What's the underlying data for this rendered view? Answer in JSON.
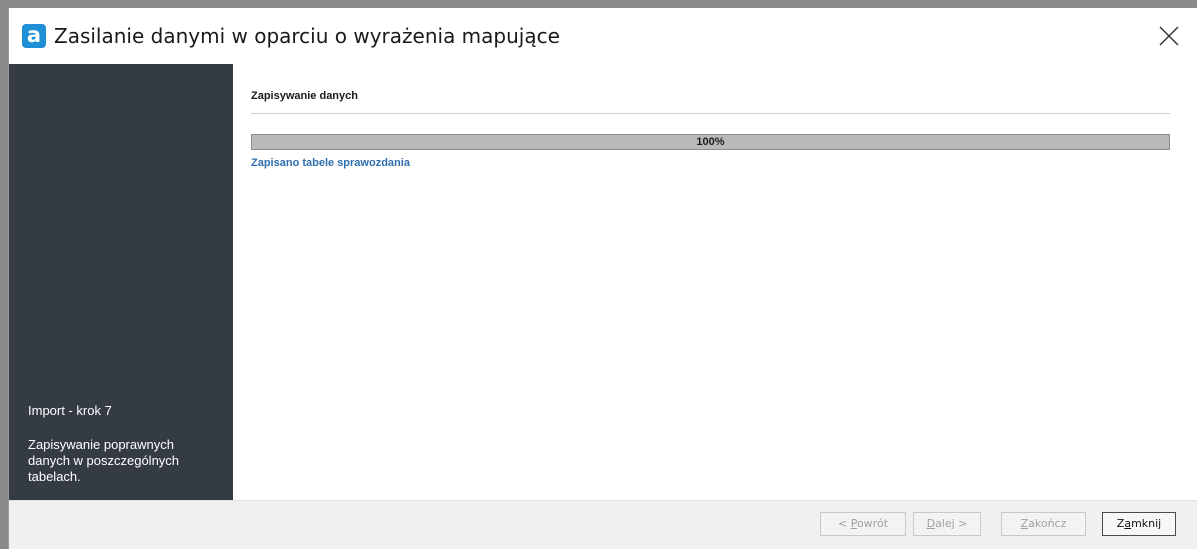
{
  "window": {
    "app_icon_letter": "a",
    "title": "Zasilanie danymi w oparciu o wyrażenia mapujące",
    "close_symbol": "close-icon"
  },
  "sidebar": {
    "step": "Import - krok 7",
    "description": "Zapisywanie poprawnych danych w poszczególnych tabelach."
  },
  "content": {
    "section_title": "Zapisywanie danych",
    "progress": {
      "value": 1.0,
      "label": "100%"
    },
    "status": "Zapisano tabele sprawozdania"
  },
  "footer": {
    "back": {
      "pre": "< ",
      "mnemonic": "P",
      "post": "owrót",
      "enabled": false
    },
    "next": {
      "pre": "",
      "mnemonic": "D",
      "post": "alej >",
      "enabled": false
    },
    "finish": {
      "pre": "",
      "mnemonic": "Z",
      "post": "akończ",
      "enabled": false
    },
    "close": {
      "pre": "Z",
      "mnemonic": "a",
      "post": "mknij",
      "enabled": true
    }
  },
  "colors": {
    "sidebar_bg": "#353b45",
    "app_icon": "#1f8fd6",
    "status_text": "#2f6fae",
    "progress_fill": "#b9b9b9"
  }
}
